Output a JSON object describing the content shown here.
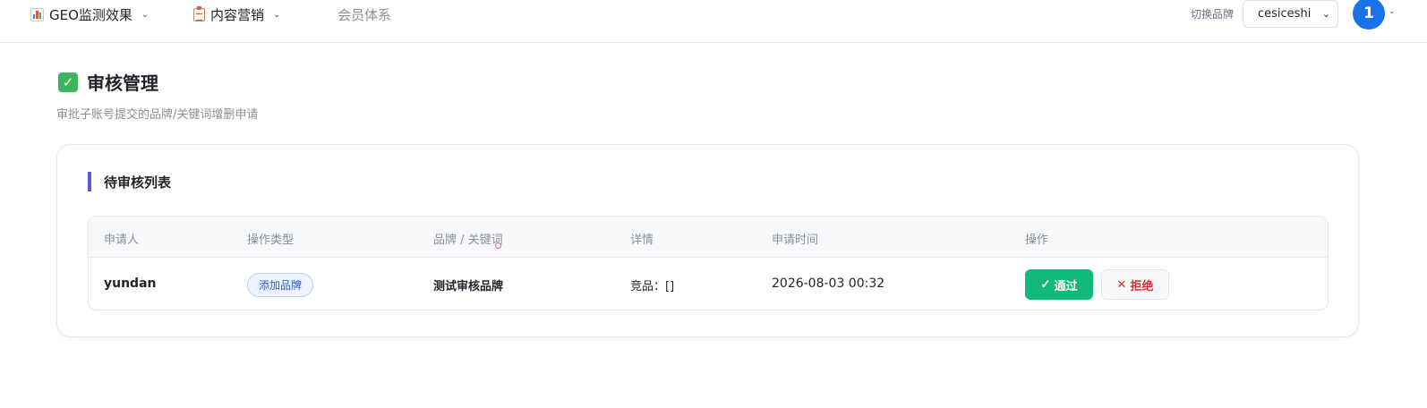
{
  "nav": {
    "items": [
      {
        "label": "GEO监测效果",
        "icon": "bar-chart-icon",
        "has_dropdown": true
      },
      {
        "label": "内容营销",
        "icon": "clipboard-icon",
        "has_dropdown": true
      },
      {
        "label": "会员体系",
        "has_dropdown": false
      }
    ],
    "brand_switch_label": "切换品牌",
    "brand_selected": "cesiceshi",
    "avatar_text": "1"
  },
  "page": {
    "title": "审核管理",
    "subtitle": "审批子账号提交的品牌/关键词增删申请"
  },
  "pending": {
    "section_title": "待审核列表",
    "columns": [
      "申请人",
      "操作类型",
      "品牌 / 关键词",
      "详情",
      "申请时间",
      "操作"
    ],
    "rows": [
      {
        "applicant": "yundan",
        "action_type": "添加品牌",
        "target": "测试审核品牌",
        "detail": "竞品：[]",
        "time": "2026-08-03 00:32",
        "approve_label": "通过",
        "reject_label": "拒绝"
      }
    ]
  },
  "colors": {
    "primary": "#1a73e8",
    "approve": "#13b97c",
    "reject": "#d93030",
    "accent_bar": "#5b5bd6"
  }
}
